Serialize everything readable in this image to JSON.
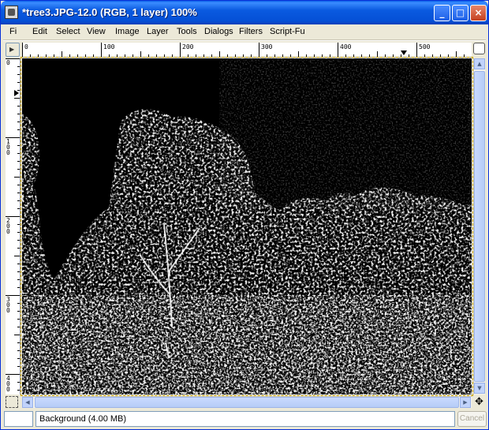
{
  "window": {
    "title": "*tree3.JPG-12.0 (RGB, 1 layer) 100%",
    "minimize_glyph": "_",
    "maximize_glyph": "□",
    "close_glyph": "×"
  },
  "menu": {
    "items": [
      "Fi",
      "Edit",
      "Select",
      "View",
      "Image",
      "Layer",
      "Tools",
      "Dialogs",
      "Filters",
      "Script-Fu"
    ]
  },
  "ruler": {
    "horizontal_labels": [
      "0",
      "100",
      "200",
      "300",
      "400",
      "500"
    ],
    "vertical_labels": [
      "0",
      "100",
      "200",
      "300",
      "400"
    ]
  },
  "status": {
    "layer_info": "Background (4.00 MB)",
    "cancel_label": "Cancel"
  },
  "navigate_glyph": "✥",
  "image_description": "edge-detected tree photo, white lines on black",
  "colors": {
    "titlebar": "#0a5ae0",
    "close_button": "#c4401f",
    "canvas_background": "#000000",
    "selection_border": "#c6a000"
  }
}
